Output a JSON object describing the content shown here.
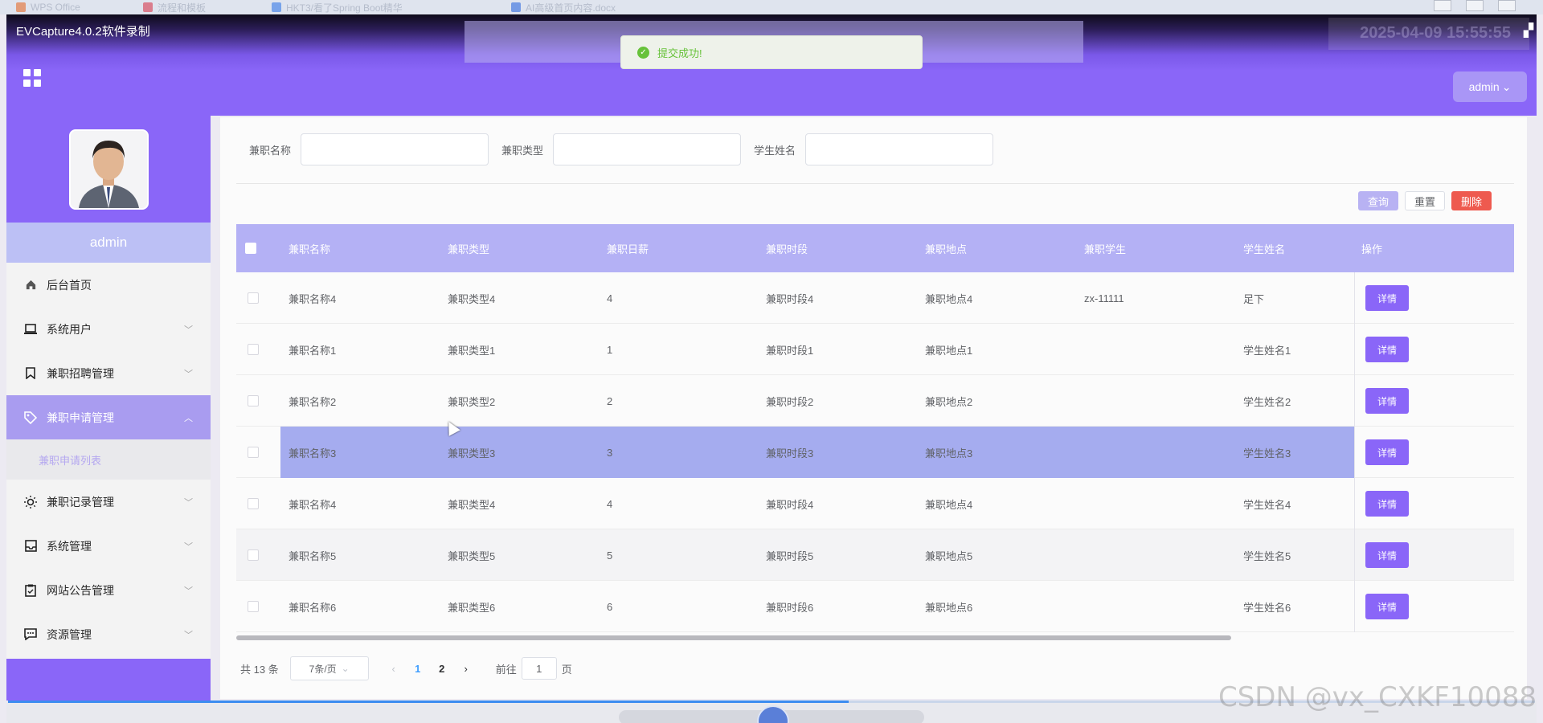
{
  "os_bar": {
    "tabs": [
      "WPS Office",
      "流程和模板",
      "HKT3/看了Spring Boot精华",
      "AI高级首页内容.docx"
    ]
  },
  "header": {
    "recorder_title": "EVCapture4.0.2软件录制",
    "clock": "2025-04-09 15:55:55",
    "admin_label": "admin",
    "toast": "提交成功!"
  },
  "sidebar": {
    "username": "admin",
    "items": [
      {
        "label": "后台首页",
        "icon": "home-icon"
      },
      {
        "label": "系统用户",
        "icon": "laptop-icon"
      },
      {
        "label": "兼职招聘管理",
        "icon": "bookmark-icon"
      },
      {
        "label": "兼职申请管理",
        "icon": "tag-icon"
      },
      {
        "label": "兼职记录管理",
        "icon": "sun-icon"
      },
      {
        "label": "系统管理",
        "icon": "inbox-icon"
      },
      {
        "label": "网站公告管理",
        "icon": "clipboard-icon"
      },
      {
        "label": "资源管理",
        "icon": "chat-icon"
      }
    ],
    "submenu": "兼职申请列表"
  },
  "filters": {
    "name_label": "兼职名称",
    "type_label": "兼职类型",
    "student_label": "学生姓名"
  },
  "actions": {
    "query": "查询",
    "reset": "重置",
    "delete": "删除"
  },
  "table": {
    "headers": [
      "兼职名称",
      "兼职类型",
      "兼职日薪",
      "兼职时段",
      "兼职地点",
      "兼职学生",
      "学生姓名",
      "操作"
    ],
    "detail_label": "详情",
    "rows": [
      [
        "兼职名称4",
        "兼职类型4",
        "4",
        "兼职时段4",
        "兼职地点4",
        "zx-11111",
        "足下"
      ],
      [
        "兼职名称1",
        "兼职类型1",
        "1",
        "兼职时段1",
        "兼职地点1",
        "",
        "学生姓名1"
      ],
      [
        "兼职名称2",
        "兼职类型2",
        "2",
        "兼职时段2",
        "兼职地点2",
        "",
        "学生姓名2"
      ],
      [
        "兼职名称3",
        "兼职类型3",
        "3",
        "兼职时段3",
        "兼职地点3",
        "",
        "学生姓名3"
      ],
      [
        "兼职名称4",
        "兼职类型4",
        "4",
        "兼职时段4",
        "兼职地点4",
        "",
        "学生姓名4"
      ],
      [
        "兼职名称5",
        "兼职类型5",
        "5",
        "兼职时段5",
        "兼职地点5",
        "",
        "学生姓名5"
      ],
      [
        "兼职名称6",
        "兼职类型6",
        "6",
        "兼职时段6",
        "兼职地点6",
        "",
        "学生姓名6"
      ]
    ]
  },
  "pagination": {
    "total": "共 13 条",
    "page_size": "7条/页",
    "pages": [
      "1",
      "2"
    ],
    "goto_label": "前往",
    "goto_value": "1",
    "page_suffix": "页"
  },
  "watermark": "CSDN @vx_CXKF10088"
}
